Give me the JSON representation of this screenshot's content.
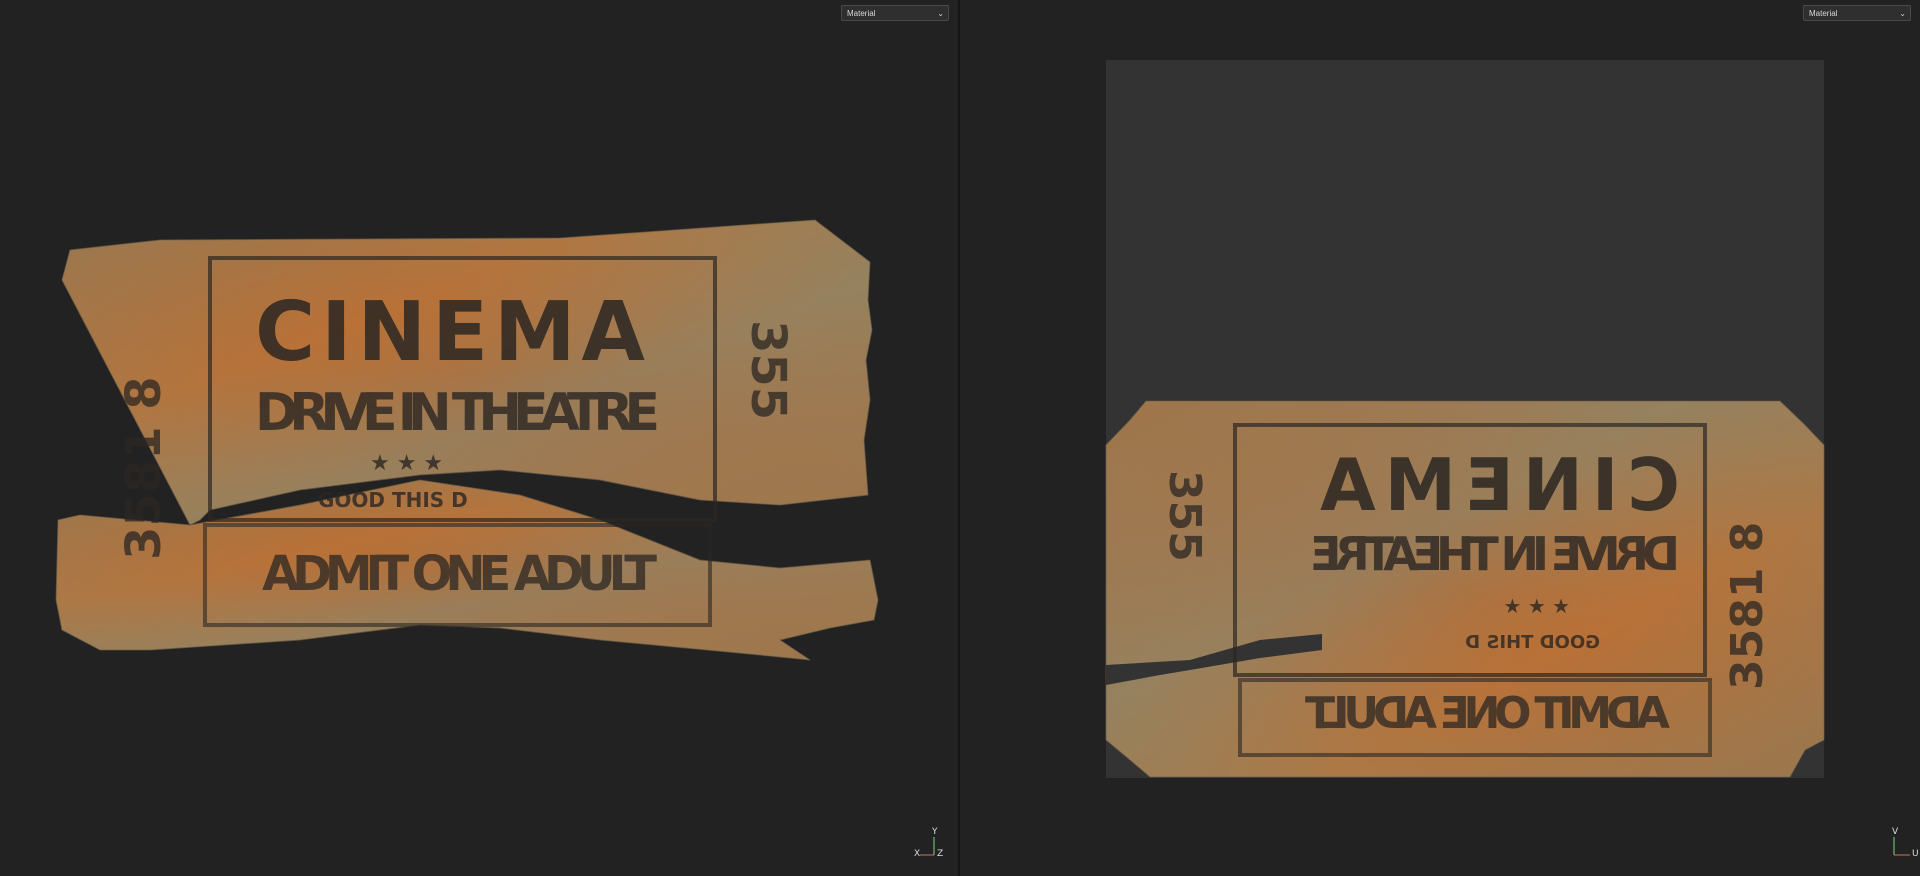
{
  "left_viewport": {
    "shading_mode": "Material",
    "axis": {
      "x": "X",
      "y": "Y",
      "z": "Z"
    },
    "ticket": {
      "title": "CINEMA",
      "subtitle": "DRIVE IN THEATRE",
      "stars": "★ ★ ★",
      "good": "GOOD THIS D",
      "admit": "ADMIT ONE ADULT",
      "serial_left": "3581 8",
      "serial_right": "355"
    }
  },
  "right_viewport": {
    "shading_mode": "Material",
    "axis": {
      "y": "V",
      "x": "U"
    },
    "ticket": {
      "title": "CINEMA",
      "subtitle": "DRIVE IN THEATRE",
      "stars": "★ ★ ★",
      "good": "GOOD THIS D",
      "admit": "ADMIT ONE ADULT",
      "serial_left": "355",
      "serial_right": "3581 8"
    }
  },
  "colors": {
    "background": "#222222",
    "uv_canvas": "#333333",
    "ticket_orange": "#b8632a",
    "ticket_grime": "#8a8a6a",
    "ink": "#2b2622"
  }
}
